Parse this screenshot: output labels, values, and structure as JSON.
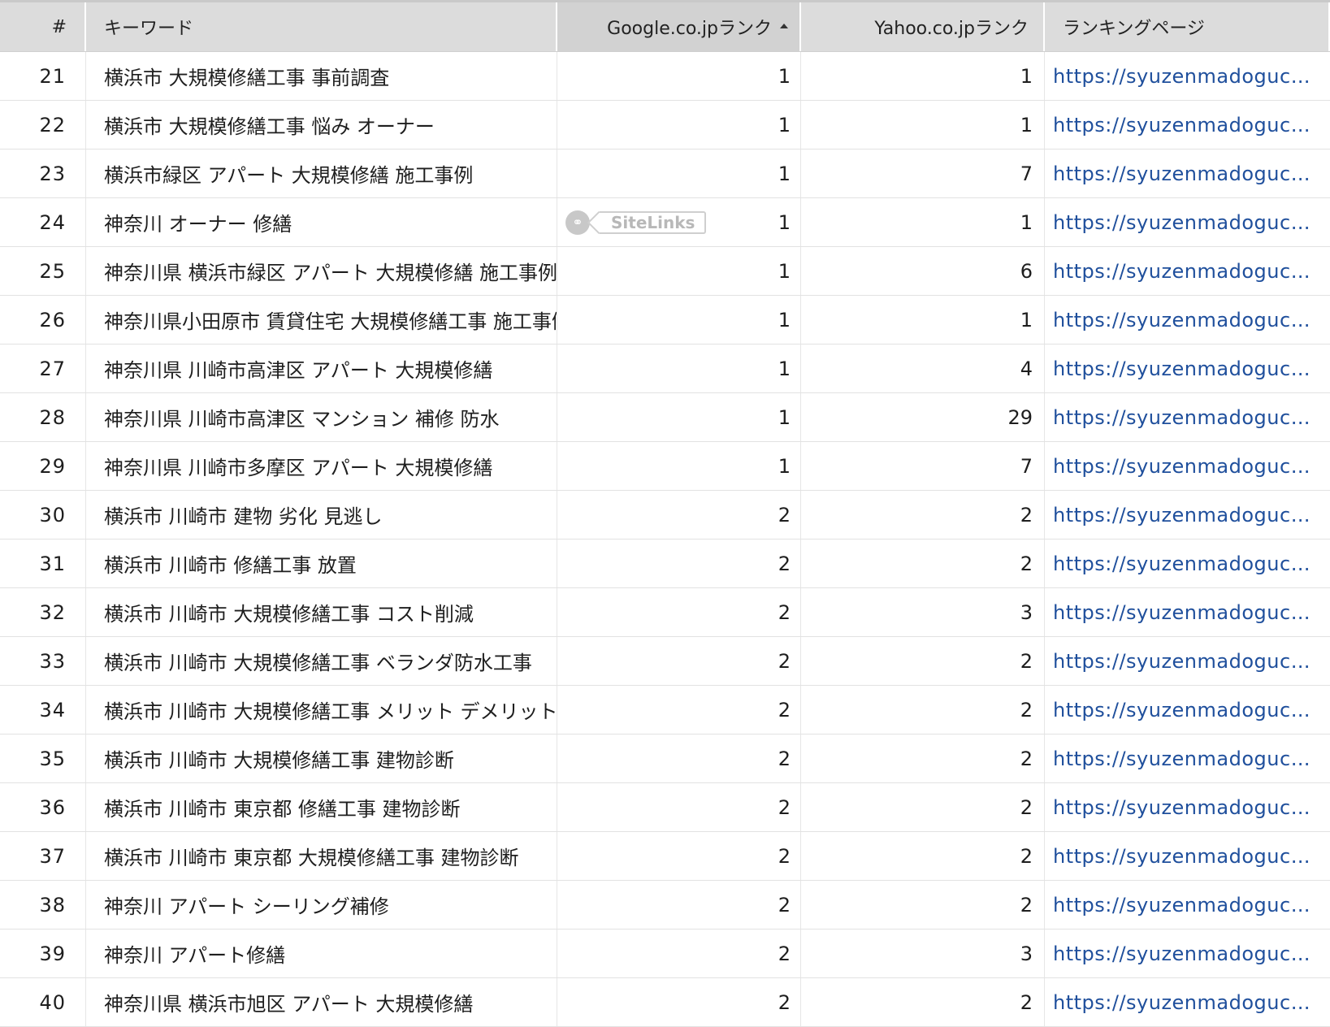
{
  "table": {
    "columns": {
      "num": "#",
      "keyword": "キーワード",
      "google": "Google.co.jpランク",
      "yahoo": "Yahoo.co.jpランク",
      "page": "ランキングページ"
    },
    "sitelinks_label": "SiteLinks",
    "rows": [
      {
        "num": "21",
        "keyword": "横浜市 大規模修繕工事 事前調査",
        "google": "1",
        "yahoo": "1",
        "url": "https://syuzenmadoguchi...."
      },
      {
        "num": "22",
        "keyword": "横浜市 大規模修繕工事 悩み オーナー",
        "google": "1",
        "yahoo": "1",
        "url": "https://syuzenmadoguchi...."
      },
      {
        "num": "23",
        "keyword": "横浜市緑区 アパート 大規模修繕 施工事例",
        "google": "1",
        "yahoo": "7",
        "url": "https://syuzenmadoguchi...."
      },
      {
        "num": "24",
        "keyword": "神奈川 オーナー 修繕",
        "google": "1",
        "yahoo": "1",
        "url": "https://syuzenmadoguchi....",
        "sitelinks": true
      },
      {
        "num": "25",
        "keyword": "神奈川県 横浜市緑区 アパート 大規模修繕 施工事例",
        "google": "1",
        "yahoo": "6",
        "url": "https://syuzenmadoguchi...."
      },
      {
        "num": "26",
        "keyword": "神奈川県小田原市 賃貸住宅 大規模修繕工事 施工事例",
        "google": "1",
        "yahoo": "1",
        "url": "https://syuzenmadoguchi...."
      },
      {
        "num": "27",
        "keyword": "神奈川県 川崎市高津区 アパート 大規模修繕",
        "google": "1",
        "yahoo": "4",
        "url": "https://syuzenmadoguchi...."
      },
      {
        "num": "28",
        "keyword": "神奈川県 川崎市高津区 マンション 補修 防水",
        "google": "1",
        "yahoo": "29",
        "url": "https://syuzenmadoguchi...."
      },
      {
        "num": "29",
        "keyword": "神奈川県 川崎市多摩区 アパート 大規模修繕",
        "google": "1",
        "yahoo": "7",
        "url": "https://syuzenmadoguchi...."
      },
      {
        "num": "30",
        "keyword": "横浜市 川崎市 建物 劣化 見逃し",
        "google": "2",
        "yahoo": "2",
        "url": "https://syuzenmadoguchi...."
      },
      {
        "num": "31",
        "keyword": "横浜市 川崎市 修繕工事 放置",
        "google": "2",
        "yahoo": "2",
        "url": "https://syuzenmadoguchi...."
      },
      {
        "num": "32",
        "keyword": "横浜市 川崎市 大規模修繕工事 コスト削減",
        "google": "2",
        "yahoo": "3",
        "url": "https://syuzenmadoguchi...."
      },
      {
        "num": "33",
        "keyword": "横浜市 川崎市 大規模修繕工事 ベランダ防水工事",
        "google": "2",
        "yahoo": "2",
        "url": "https://syuzenmadoguchi...."
      },
      {
        "num": "34",
        "keyword": "横浜市 川崎市 大規模修繕工事 メリット デメリット",
        "google": "2",
        "yahoo": "2",
        "url": "https://syuzenmadoguchi...."
      },
      {
        "num": "35",
        "keyword": "横浜市 川崎市 大規模修繕工事 建物診断",
        "google": "2",
        "yahoo": "2",
        "url": "https://syuzenmadoguchi...."
      },
      {
        "num": "36",
        "keyword": "横浜市 川崎市 東京都 修繕工事 建物診断",
        "google": "2",
        "yahoo": "2",
        "url": "https://syuzenmadoguchi...."
      },
      {
        "num": "37",
        "keyword": "横浜市 川崎市 東京都 大規模修繕工事 建物診断",
        "google": "2",
        "yahoo": "2",
        "url": "https://syuzenmadoguchi...."
      },
      {
        "num": "38",
        "keyword": "神奈川 アパート シーリング補修",
        "google": "2",
        "yahoo": "2",
        "url": "https://syuzenmadoguchi...."
      },
      {
        "num": "39",
        "keyword": "神奈川 アパート修繕",
        "google": "2",
        "yahoo": "3",
        "url": "https://syuzenmadoguchi...."
      },
      {
        "num": "40",
        "keyword": "神奈川県 横浜市旭区 アパート 大規模修繕",
        "google": "2",
        "yahoo": "2",
        "url": "https://syuzenmadoguchi...."
      }
    ]
  }
}
